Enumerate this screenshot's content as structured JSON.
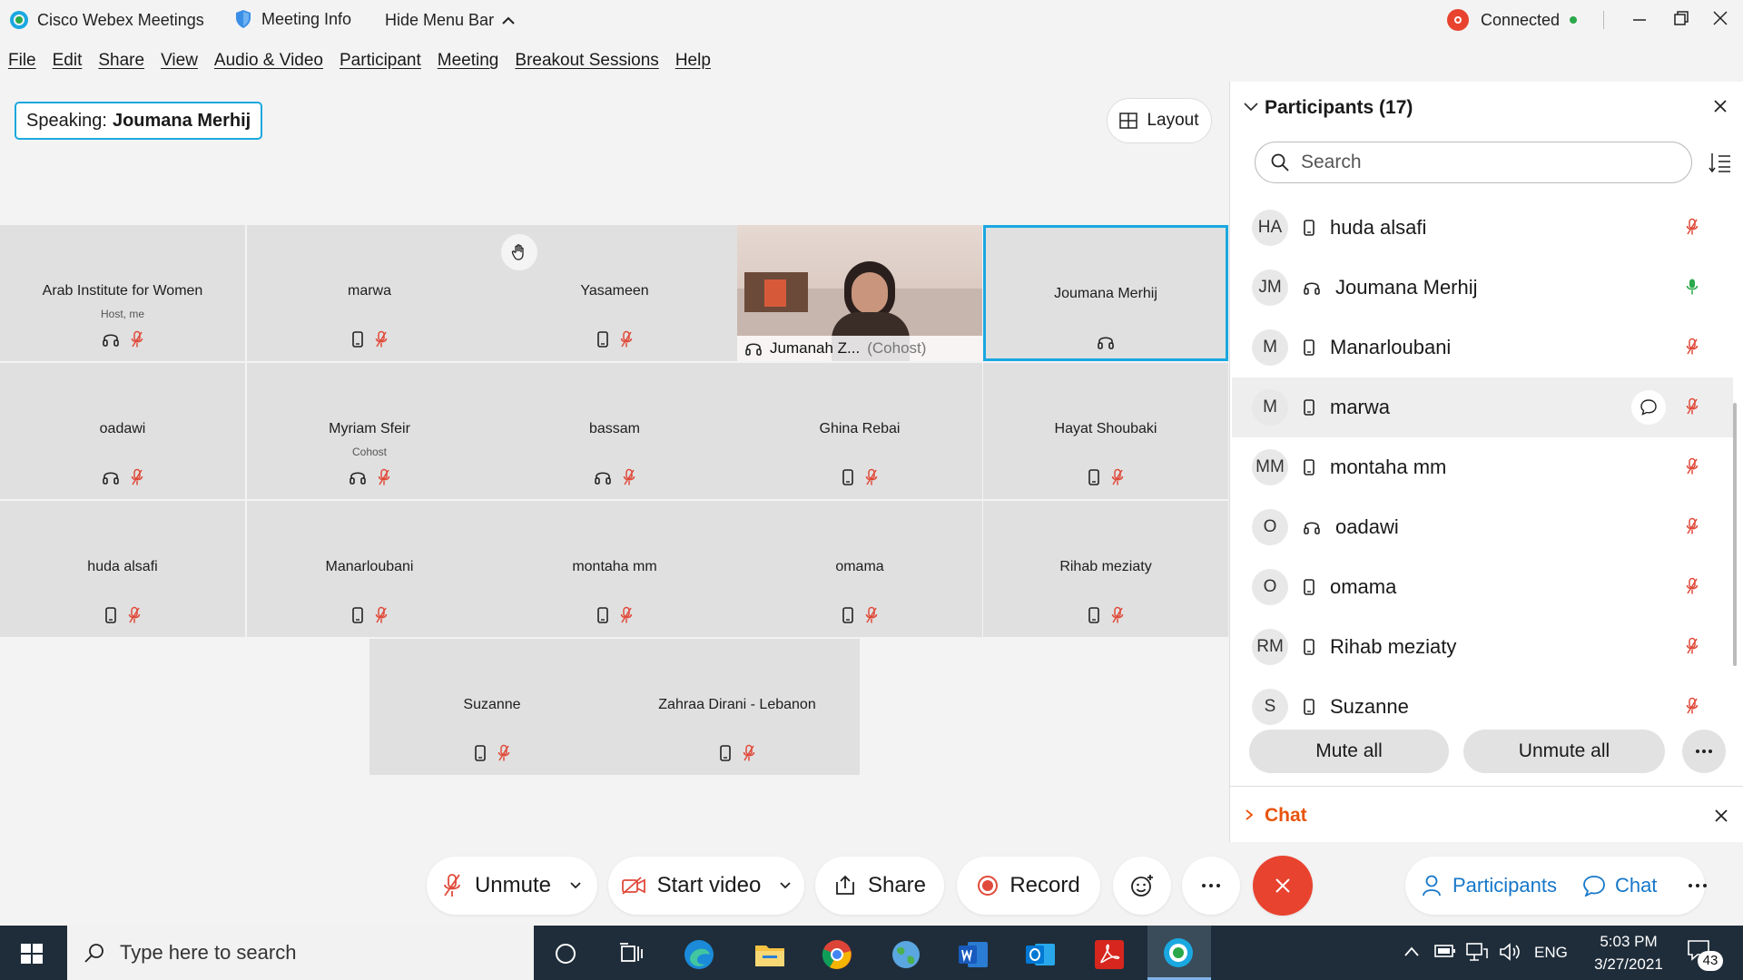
{
  "window": {
    "app_title": "Cisco Webex Meetings",
    "meeting_info": "Meeting Info",
    "hide_menu": "Hide Menu Bar",
    "status": "Connected"
  },
  "menu": [
    "File",
    "Edit",
    "Share",
    "View",
    "Audio & Video",
    "Participant",
    "Meeting",
    "Breakout Sessions",
    "Help"
  ],
  "speaking": {
    "prefix": "Speaking:",
    "name": "Joumana Merhij"
  },
  "layout_button": "Layout",
  "tiles": [
    {
      "name": "Arab Institute for Women",
      "sub": "Host, me",
      "device": "headset"
    },
    {
      "name": "marwa",
      "sub": "",
      "device": "phone"
    },
    {
      "name": "Yasameen",
      "sub": "",
      "device": "phone"
    },
    {
      "name": "Jumanah Z...",
      "sub": "(Cohost)",
      "device": "headset"
    },
    {
      "name": "Joumana Merhij",
      "sub": "",
      "device": "headset"
    },
    {
      "name": "oadawi",
      "sub": "",
      "device": "headset"
    },
    {
      "name": "Myriam Sfeir",
      "sub": "Cohost",
      "device": "headset"
    },
    {
      "name": "bassam",
      "sub": "",
      "device": "headset"
    },
    {
      "name": "Ghina Rebai",
      "sub": "",
      "device": "phone"
    },
    {
      "name": "Hayat Shoubaki",
      "sub": "",
      "device": "phone"
    },
    {
      "name": "huda alsafi",
      "sub": "",
      "device": "phone"
    },
    {
      "name": "Manarloubani",
      "sub": "",
      "device": "phone"
    },
    {
      "name": "montaha mm",
      "sub": "",
      "device": "phone"
    },
    {
      "name": "omama",
      "sub": "",
      "device": "phone"
    },
    {
      "name": "Rihab meziaty",
      "sub": "",
      "device": "phone"
    },
    {
      "name": "Suzanne",
      "sub": "",
      "device": "phone"
    },
    {
      "name": "Zahraa Dirani - Lebanon",
      "sub": "",
      "device": "phone"
    }
  ],
  "participants": {
    "title": "Participants (17)",
    "search_placeholder": "Search",
    "list": [
      {
        "initials": "HA",
        "name": "huda alsafi",
        "device": "phone",
        "mic": "muted"
      },
      {
        "initials": "JM",
        "name": "Joumana Merhij",
        "device": "headset",
        "mic": "active"
      },
      {
        "initials": "M",
        "name": "Manarloubani",
        "device": "phone",
        "mic": "muted"
      },
      {
        "initials": "M",
        "name": "marwa",
        "device": "phone",
        "mic": "muted"
      },
      {
        "initials": "MM",
        "name": "montaha mm",
        "device": "phone",
        "mic": "muted"
      },
      {
        "initials": "O",
        "name": "oadawi",
        "device": "headset",
        "mic": "muted"
      },
      {
        "initials": "O",
        "name": "omama",
        "device": "phone",
        "mic": "muted"
      },
      {
        "initials": "RM",
        "name": "Rihab meziaty",
        "device": "phone",
        "mic": "muted"
      },
      {
        "initials": "S",
        "name": "Suzanne",
        "device": "phone",
        "mic": "muted"
      }
    ],
    "mute_all": "Mute all",
    "unmute_all": "Unmute all"
  },
  "chat_section": "Chat",
  "controls": {
    "unmute": "Unmute",
    "start_video": "Start video",
    "share": "Share",
    "record": "Record",
    "participants": "Participants",
    "chat": "Chat"
  },
  "taskbar": {
    "search_placeholder": "Type here to search",
    "lang": "ENG",
    "time": "5:03 PM",
    "date": "3/27/2021",
    "notifications": "43"
  },
  "colors": {
    "accent": "#1aa8e0",
    "muted_red": "#e04a3a",
    "end_red": "#e8432f",
    "chat_orange": "#e8540e",
    "active_green": "#2aa84a"
  }
}
